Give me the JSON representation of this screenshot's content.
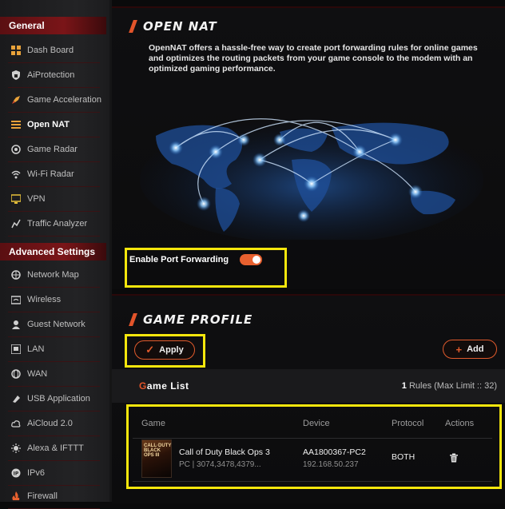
{
  "sidebar": {
    "general_label": "General",
    "advanced_label": "Advanced Settings",
    "items": [
      {
        "label": "Dash Board",
        "icon": "dashboard-icon"
      },
      {
        "label": "AiProtection",
        "icon": "shield-icon"
      },
      {
        "label": "Game Acceleration",
        "icon": "rocket-icon"
      },
      {
        "label": "Open NAT",
        "icon": "open-nat-icon",
        "active": true
      },
      {
        "label": "Game Radar",
        "icon": "radar-icon"
      },
      {
        "label": "Wi-Fi Radar",
        "icon": "wifi-radar-icon"
      },
      {
        "label": "VPN",
        "icon": "vpn-icon"
      },
      {
        "label": "Traffic Analyzer",
        "icon": "traffic-analyzer-icon"
      }
    ],
    "advanced_items": [
      {
        "label": "Network Map",
        "icon": "network-map-icon"
      },
      {
        "label": "Wireless",
        "icon": "wireless-icon"
      },
      {
        "label": "Guest Network",
        "icon": "guest-network-icon"
      },
      {
        "label": "LAN",
        "icon": "lan-icon"
      },
      {
        "label": "WAN",
        "icon": "wan-icon"
      },
      {
        "label": "USB Application",
        "icon": "usb-icon"
      },
      {
        "label": "AiCloud 2.0",
        "icon": "cloud-icon"
      },
      {
        "label": "Alexa & IFTTT",
        "icon": "alexa-icon"
      },
      {
        "label": "IPv6",
        "icon": "ipv6-icon"
      },
      {
        "label": "Firewall",
        "icon": "firewall-icon"
      }
    ]
  },
  "open_nat": {
    "title": "OPEN NAT",
    "description": "OpenNAT offers a hassle-free way to create port forwarding rules for online games and optimizes the routing packets from your game console to the modem with an optimized gaming performance.",
    "enable_label": "Enable Port Forwarding",
    "enabled": true
  },
  "game_profile": {
    "title": "GAME PROFILE",
    "apply_label": "Apply",
    "add_label": "Add",
    "list_title_first": "G",
    "list_title_rest": "ame List",
    "rules_count": "1",
    "rules_suffix": "Rules (Max Limit :: 32)",
    "columns": {
      "game": "Game",
      "device": "Device",
      "protocol": "Protocol",
      "actions": "Actions"
    },
    "rows": [
      {
        "thumb_caption": "CALL·DUTY BLACK OPS III",
        "game": "Call of Duty Black Ops 3",
        "platform_ports": "PC  |  3074,3478,4379...",
        "device": "AA1800367-PC2",
        "ip": "192.168.50.237",
        "protocol": "BOTH"
      }
    ]
  },
  "colors": {
    "accent": "#e2542a",
    "highlight": "#f5e60c",
    "sidebar_header": "#6a1215"
  }
}
